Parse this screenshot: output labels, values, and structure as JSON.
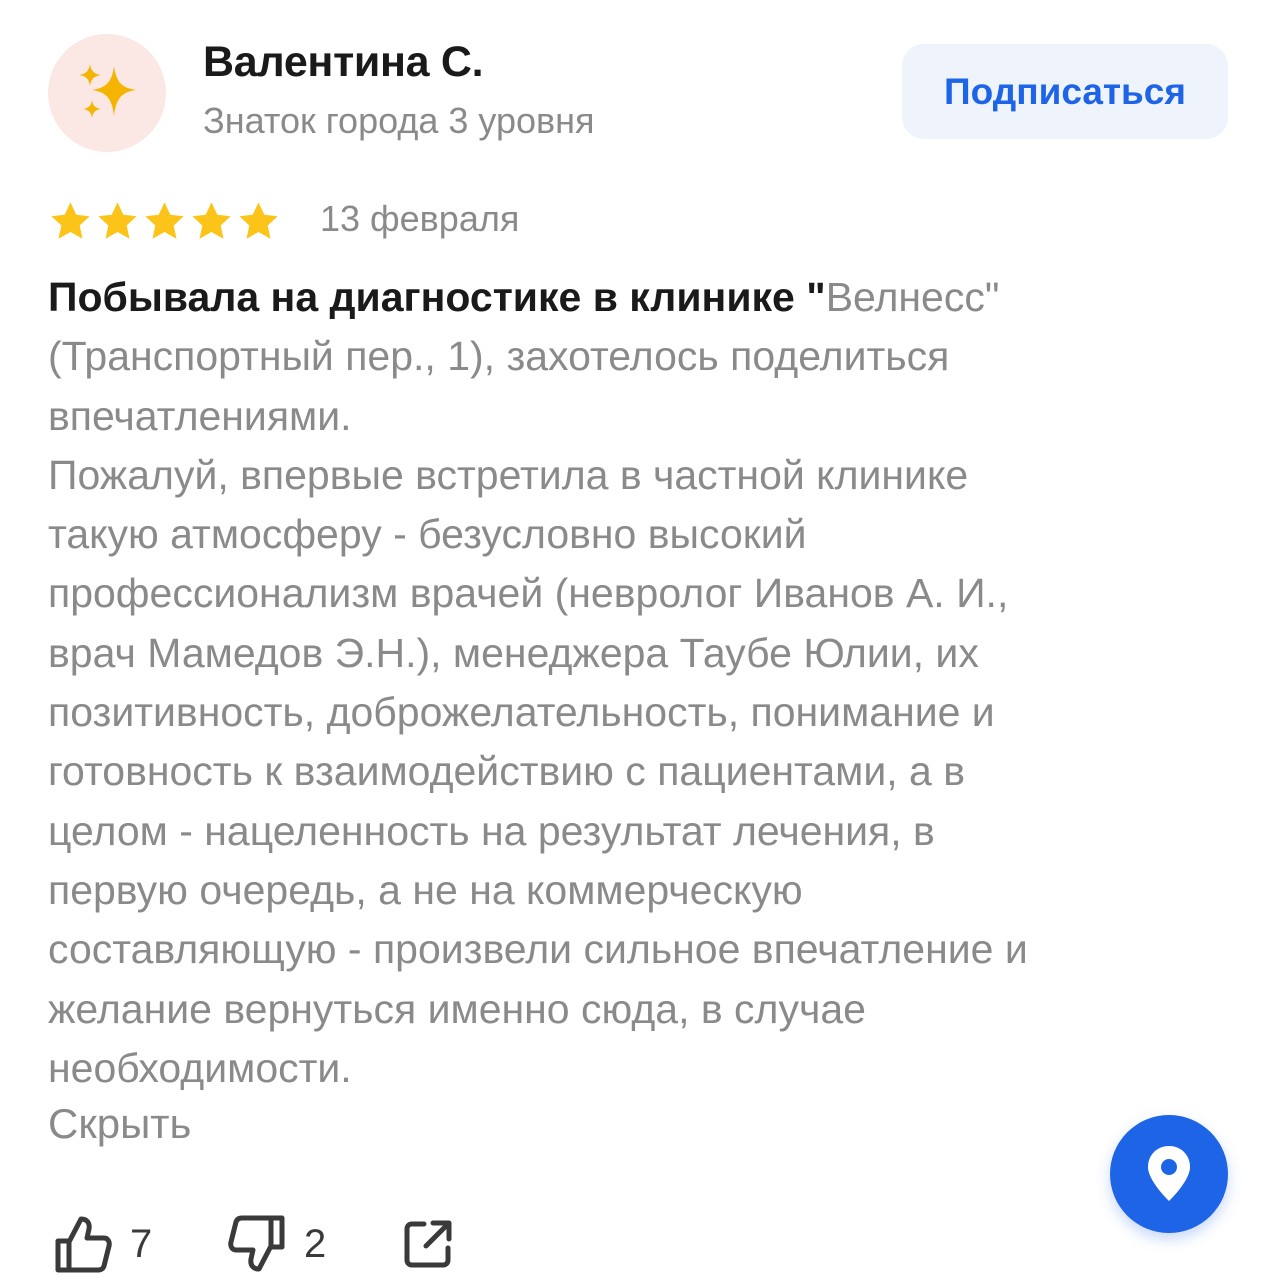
{
  "author": {
    "name": "Валентина С.",
    "level": "Знаток города 3 уровня",
    "avatar_icon": "sparkles-icon",
    "avatar_bg": "#fbe7e3"
  },
  "subscribe_label": "Подписаться",
  "rating": {
    "value": 5,
    "max": 5,
    "color": "#fcc419"
  },
  "date": "13 февраля",
  "review": {
    "line1_bold": "Побывала на диагностике в клинике \"",
    "line1_rest": "Велнесс\"",
    "lines": [
      "(Транспортный пер., 1), захотелось поделиться",
      "впечатлениями.",
      "Пожалуй, впервые встретила в частной клинике",
      "такую атмосферу - безусловно высокий",
      "профессионализм врачей (невролог Иванов А. И.,",
      "врач Мамедов Э.Н.), менеджера Таубе Юлии, их",
      "позитивность, доброжелательность, понимание и",
      "готовность к взаимодействию с пациентами, а в",
      "целом - нацеленность на результат лечения, в",
      "первую очередь, а не на коммерческую",
      "составляющую - произвели сильное впечатление и",
      "желание вернуться именно сюда, в случае",
      "необходимости."
    ]
  },
  "hide_label": "Скрыть",
  "actions": {
    "likes": "7",
    "dislikes": "2"
  },
  "colors": {
    "accent": "#1e64e6",
    "muted_text": "#8a8a8a",
    "primary_text": "#1a1a1a"
  }
}
